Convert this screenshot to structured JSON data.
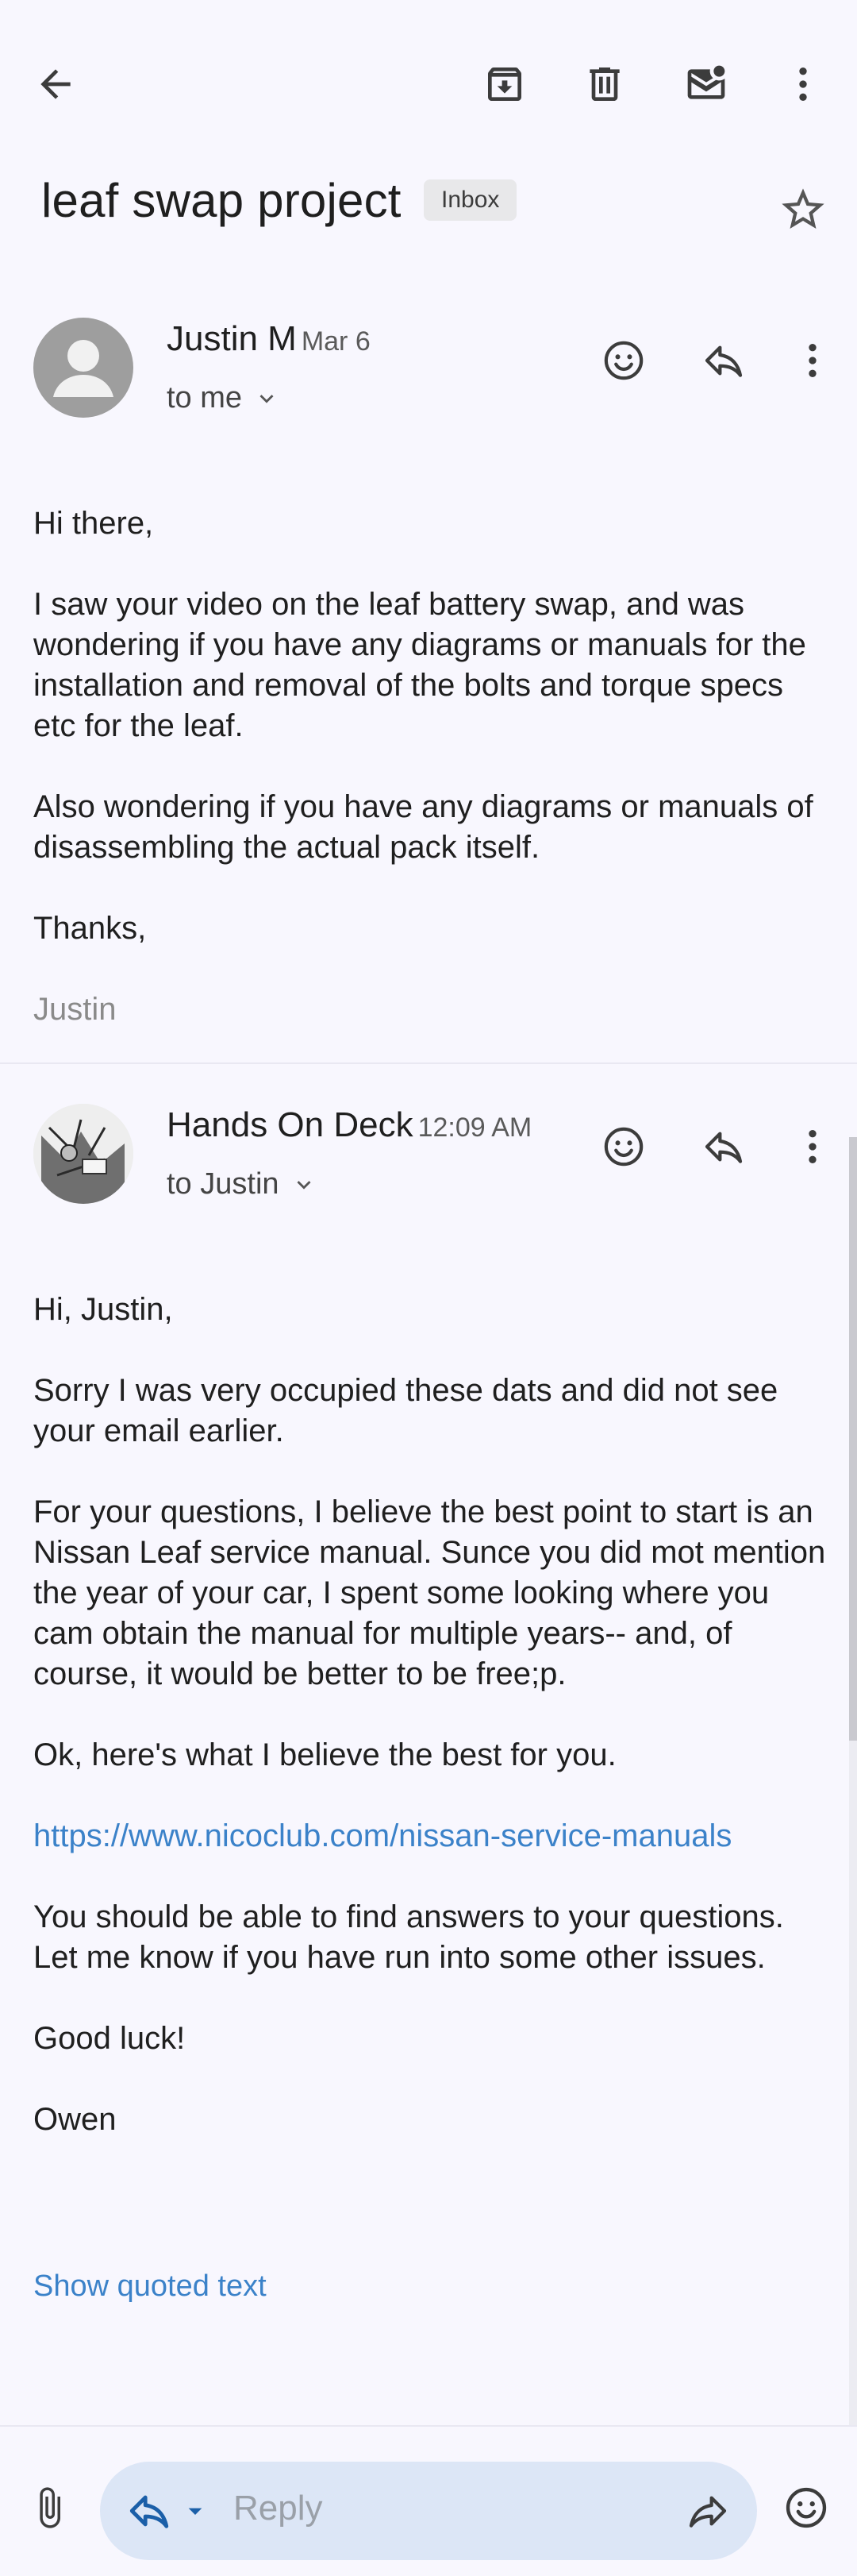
{
  "toolbar": {
    "back": "arrow-left-icon",
    "archive": "archive-icon",
    "delete": "trash-icon",
    "mark_unread": "mail-unread-icon",
    "more": "more-vert-icon"
  },
  "thread": {
    "subject": "leaf swap project",
    "label": "Inbox"
  },
  "messages": [
    {
      "sender": "Justin M",
      "time": "Mar 6",
      "recipient": "to me",
      "body": [
        "Hi there,",
        "I saw your video on the leaf battery swap, and was wondering if you have any diagrams or manuals for the installation and removal of the bolts and torque specs etc for the leaf.",
        "Also wondering if you have any diagrams or manuals of disassembling the actual pack itself.",
        "Thanks,"
      ],
      "signature": "Justin"
    },
    {
      "sender": "Hands On Deck",
      "time": "12:09 AM",
      "recipient": "to Justin",
      "body": [
        "Hi, Justin,",
        "Sorry I was very occupied these dats and did not see your email earlier.",
        "For your questions, I believe the best point to start is an Nissan Leaf service manual. Sunce you did mot mention the year of your car, I spent some looking where you cam obtain the manual for multiple years-- and, of course, it would be better to be free;p.",
        "Ok, here's what I believe the best for you."
      ],
      "link": "https://www.nicoclub.com/nissan-service-manuals",
      "body2": [
        "You should be able to find answers to your questions. Let me know if you have run into some other issues.",
        "Good luck!",
        "Owen"
      ],
      "show_quoted": "Show quoted text"
    }
  ],
  "reply_bar": {
    "placeholder": "Reply"
  },
  "colors": {
    "background": "#f8f7fe",
    "link": "#3b82c9",
    "reply_pill": "#dce6f6",
    "reply_icon": "#1b5fa8"
  }
}
